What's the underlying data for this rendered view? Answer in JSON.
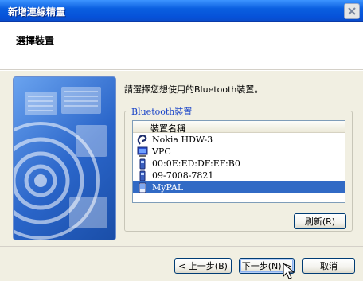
{
  "window": {
    "title": "新增連線精靈",
    "close_icon": "close-icon"
  },
  "header": {
    "title": "選擇裝置"
  },
  "main": {
    "prompt": "請選擇您想使用的Bluetooth裝置。",
    "group_label": "Bluetooth裝置",
    "list_header": "裝置名稱",
    "devices": [
      {
        "name": "Nokia HDW-3",
        "icon": "headset-icon"
      },
      {
        "name": "VPC",
        "icon": "computer-icon"
      },
      {
        "name": "00:0E:ED:DF:EF:B0",
        "icon": "phone-icon"
      },
      {
        "name": "09-7008-7821",
        "icon": "phone-icon"
      },
      {
        "name": "MyPAL",
        "icon": "pda-icon",
        "selected": true
      }
    ],
    "refresh_label": "刷新(R)"
  },
  "footer": {
    "back_label": "< 上一步(B)",
    "next_label": "下一步(N) >",
    "cancel_label": "取消"
  },
  "colors": {
    "title_bar": "#0a5fe0",
    "selection": "#316ac5",
    "group_label": "#1a44c8"
  }
}
